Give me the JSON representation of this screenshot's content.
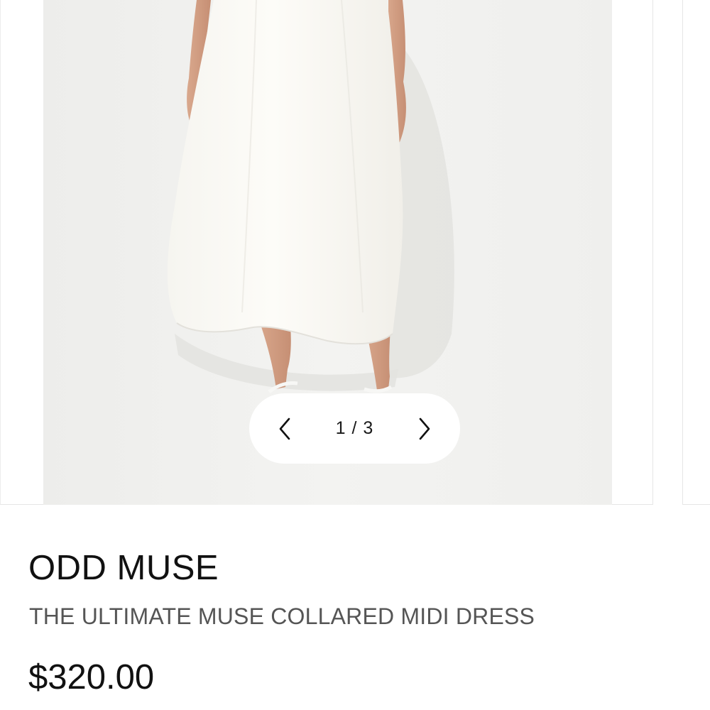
{
  "carousel": {
    "counter": "1 / 3",
    "prev_icon": "chevron-left-icon",
    "next_icon": "chevron-right-icon",
    "current": 1,
    "total": 3
  },
  "product": {
    "brand": "ODD MUSE",
    "name": "THE ULTIMATE MUSE COLLARED MIDI DRESS",
    "price": "$320.00"
  },
  "colors": {
    "image_background": "#f1f1ef",
    "dress": "#fbfaf6",
    "text_primary": "#111111",
    "text_secondary": "#555555"
  }
}
